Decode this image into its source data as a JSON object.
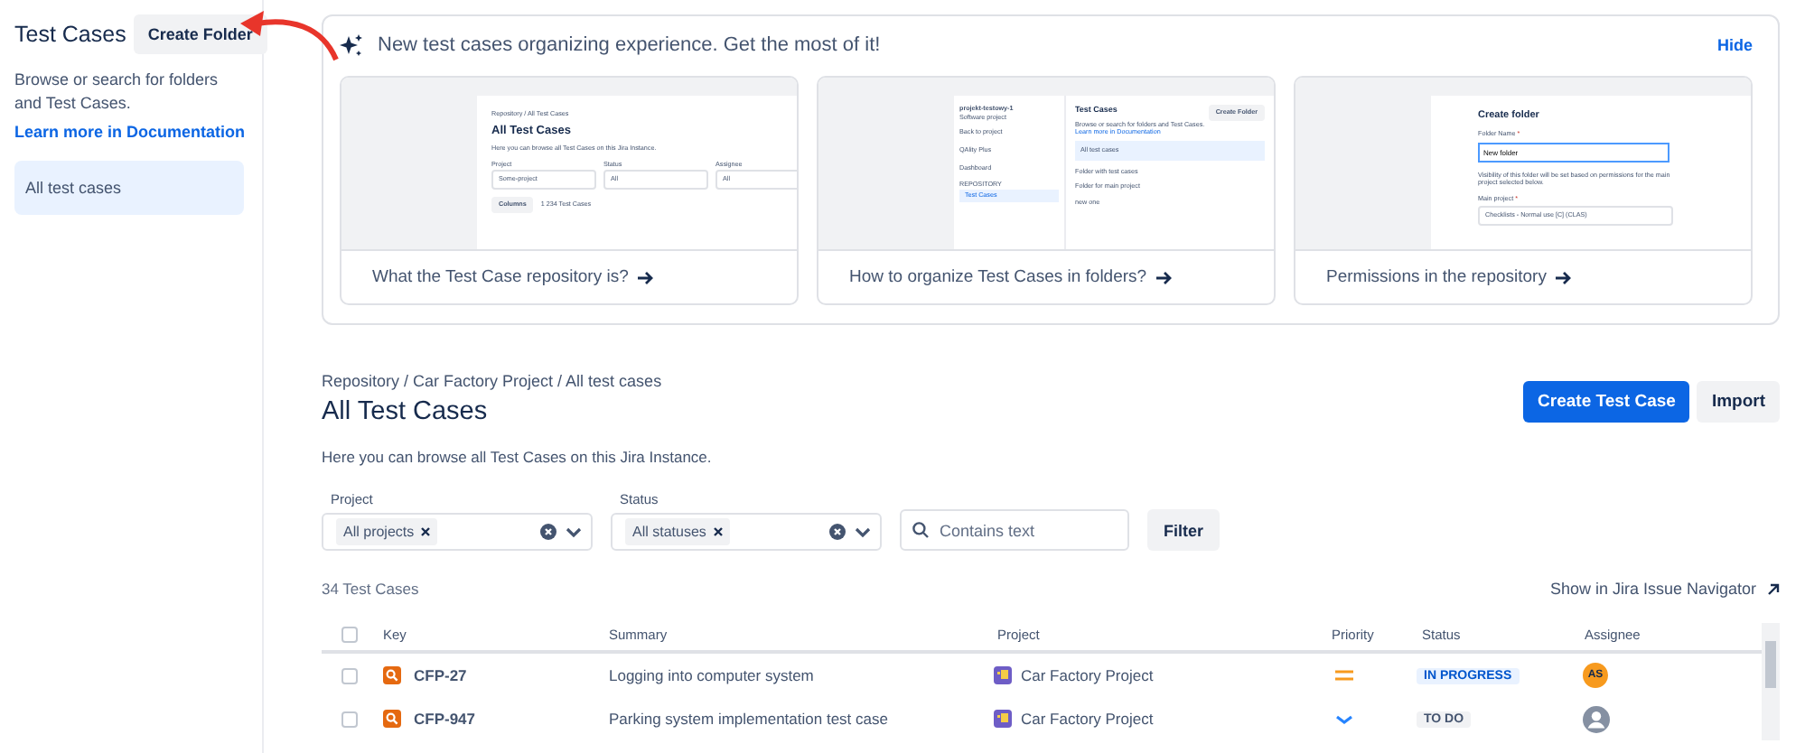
{
  "sidebar": {
    "title": "Test Cases",
    "create_button": "Create Folder",
    "description": "Browse or search for folders and Test Cases.",
    "doc_link": "Learn more in Documentation",
    "items": [
      {
        "label": "All test cases",
        "selected": true
      }
    ]
  },
  "banner": {
    "title": "New test cases organizing experience. Get the most of it!",
    "hide_link": "Hide",
    "cards": [
      {
        "kind": "list",
        "caption": "What the Test Case repository is?",
        "preview": {
          "breadcrumb": "Repository / All Test Cases",
          "title": "All Test Cases",
          "description": "Here you can browse all Test Cases on this Jira Instance.",
          "labels": [
            "Project",
            "Status",
            "Assignee"
          ],
          "values": [
            "Some-project",
            "All",
            "All"
          ],
          "columns_button": "Columns",
          "count": "1 234 Test Cases"
        }
      },
      {
        "kind": "sidebar",
        "caption": "How to organize Test Cases in folders?",
        "preview": {
          "project_name": "projekt-testowy-1",
          "project_type": "Software project",
          "back": "Back to project",
          "nav": [
            "QAlity Plus",
            "Dashboard"
          ],
          "section": "REPOSITORY",
          "nav_selected": "Test Cases",
          "title": "Test Cases",
          "create_button": "Create Folder",
          "description": "Browse or search for folders and Test Cases.",
          "doc_link": "Learn more in Documentation",
          "all": "All test cases",
          "folders": [
            "Folder with test cases",
            "Folder for main project",
            "new one"
          ]
        }
      },
      {
        "kind": "form",
        "caption": "Permissions in the repository",
        "preview": {
          "title": "Create folder",
          "name_label": "Folder Name",
          "required": "*",
          "name_value": "New folder",
          "note": "Visibility of this folder will be set based on permissions for the main project selected below.",
          "project_label": "Main project",
          "project_value": "Checklists - Normal use [C] (CLAS)"
        }
      }
    ]
  },
  "breadcrumb": "Repository / Car Factory Project / All test cases",
  "page_title": "All Test Cases",
  "description": "Here you can browse all Test Cases on this Jira Instance.",
  "actions": [
    {
      "label": "Create Test Case",
      "kind": "primary"
    },
    {
      "label": "Import",
      "kind": "default"
    }
  ],
  "filters": [
    {
      "label": "Project",
      "tag": "All projects"
    },
    {
      "label": "Status",
      "tag": "All statuses"
    }
  ],
  "search": {
    "placeholder": "Contains text"
  },
  "filter_button": "Filter",
  "count": "34 Test Cases",
  "navigator_link": "Show in Jira Issue Navigator",
  "table": {
    "select_all_checked": false,
    "columns": [
      "Key",
      "Summary",
      "Project",
      "Priority",
      "Status",
      "Assignee"
    ],
    "rows": [
      {
        "checked": false,
        "key": "CFP-27",
        "summary": "Logging into computer system",
        "project": "Car Factory Project",
        "priority": {
          "kind": "medium"
        },
        "status": {
          "label": "IN PROGRESS",
          "kind": "inprogress"
        },
        "assignee": {
          "initials": "AS"
        }
      },
      {
        "checked": false,
        "key": "CFP-947",
        "summary": "Parking system implementation test case",
        "project": "Car Factory Project",
        "priority": {
          "kind": "low"
        },
        "status": {
          "label": "TO DO",
          "kind": "todo"
        },
        "assignee": {}
      }
    ]
  }
}
